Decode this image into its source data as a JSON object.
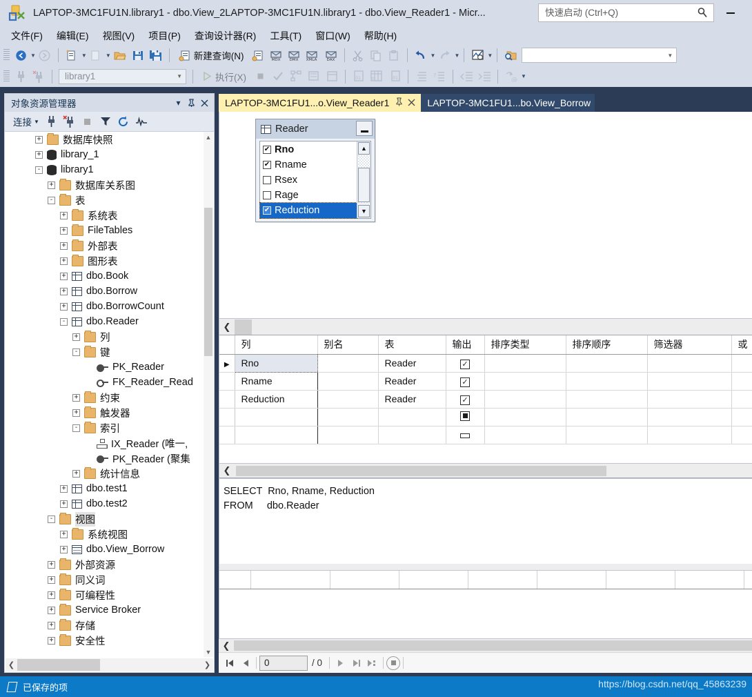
{
  "window": {
    "title": "LAPTOP-3MC1FU1N.library1 - dbo.View_2LAPTOP-3MC1FU1N.library1 - dbo.View_Reader1 - Micr...",
    "minimize_label": "",
    "app_icon": "ssms-icon"
  },
  "quick_launch": {
    "placeholder": "快速启动 (Ctrl+Q)",
    "value": "",
    "icon": "search-icon"
  },
  "menu": {
    "items": [
      {
        "label": "文件(F)"
      },
      {
        "label": "编辑(E)"
      },
      {
        "label": "视图(V)"
      },
      {
        "label": "项目(P)"
      },
      {
        "label": "查询设计器(R)"
      },
      {
        "label": "工具(T)"
      },
      {
        "label": "窗口(W)"
      },
      {
        "label": "帮助(H)"
      }
    ]
  },
  "toolbar1": {
    "new_query_label": "新建查询(N)",
    "buttons": [
      {
        "name": "navigate-back",
        "icon": "arrow-back-icon"
      },
      {
        "name": "navigate-forward",
        "icon": "arrow-forward-icon"
      },
      {
        "name": "new-project",
        "icon": "new-project-icon"
      },
      {
        "name": "add-item",
        "icon": "add-item-icon"
      },
      {
        "name": "open-file",
        "icon": "folder-open-icon"
      },
      {
        "name": "save",
        "icon": "save-icon"
      },
      {
        "name": "save-all",
        "icon": "save-all-icon"
      },
      {
        "name": "new-query",
        "icon": "new-query-icon"
      },
      {
        "name": "new-analysis-query",
        "icon": "analysis-query-icon"
      },
      {
        "name": "new-mdx-query",
        "icon": "mdx-icon",
        "text": "MDX"
      },
      {
        "name": "new-dmx-query",
        "icon": "dmx-icon",
        "text": "DMX"
      },
      {
        "name": "new-xmla-query",
        "icon": "xmla-icon",
        "text": "XMLA"
      },
      {
        "name": "new-dax-query",
        "icon": "dax-icon",
        "text": "DAX"
      },
      {
        "name": "cut",
        "icon": "scissors-icon"
      },
      {
        "name": "copy",
        "icon": "copy-icon"
      },
      {
        "name": "paste",
        "icon": "paste-icon"
      },
      {
        "name": "undo",
        "icon": "undo-icon"
      },
      {
        "name": "redo",
        "icon": "redo-icon"
      },
      {
        "name": "activity-monitor",
        "icon": "activity-monitor-icon"
      },
      {
        "name": "find-in-files",
        "icon": "find-folder-icon"
      }
    ],
    "combo_value": "",
    "combo_placeholder": ""
  },
  "toolbar2": {
    "database_combo_value": "library1",
    "execute_label": "执行(X)",
    "buttons": [
      {
        "name": "connect",
        "icon": "connect-icon"
      },
      {
        "name": "disconnect",
        "icon": "disconnect-icon"
      },
      {
        "name": "execute",
        "icon": "play-icon"
      },
      {
        "name": "stop",
        "icon": "stop-icon"
      },
      {
        "name": "parse",
        "icon": "checkmark-icon"
      },
      {
        "name": "display-estimated-plan",
        "icon": "estimated-plan-icon"
      },
      {
        "name": "include-actual-plan",
        "icon": "actual-plan-icon"
      },
      {
        "name": "include-client-statistics",
        "icon": "client-stats-icon"
      },
      {
        "name": "results-to-text",
        "icon": "results-text-icon"
      },
      {
        "name": "results-to-grid",
        "icon": "results-grid-icon"
      },
      {
        "name": "results-to-file",
        "icon": "results-file-icon"
      },
      {
        "name": "comment-lines",
        "icon": "comment-icon"
      },
      {
        "name": "uncomment-lines",
        "icon": "uncomment-icon"
      },
      {
        "name": "decrease-indent",
        "icon": "outdent-icon"
      },
      {
        "name": "increase-indent",
        "icon": "indent-icon"
      },
      {
        "name": "specify-values-template",
        "icon": "template-params-icon"
      }
    ]
  },
  "object_explorer": {
    "title": "对象资源管理器",
    "connect_label": "连接",
    "toolbar_icons": [
      {
        "name": "connect-icon"
      },
      {
        "name": "disconnect-icon"
      },
      {
        "name": "stop-icon"
      },
      {
        "name": "filter-icon"
      },
      {
        "name": "refresh-icon"
      },
      {
        "name": "activity-monitor-icon"
      }
    ],
    "tree": [
      {
        "label": "数据库快照",
        "indent": 2,
        "expander": "+",
        "icon": "folder",
        "selected": false
      },
      {
        "label": "library_1",
        "indent": 2,
        "expander": "+",
        "icon": "database",
        "selected": false
      },
      {
        "label": "library1",
        "indent": 2,
        "expander": "-",
        "icon": "database",
        "selected": false
      },
      {
        "label": "数据库关系图",
        "indent": 3,
        "expander": "+",
        "icon": "folder",
        "selected": false
      },
      {
        "label": "表",
        "indent": 3,
        "expander": "-",
        "icon": "folder",
        "selected": false
      },
      {
        "label": "系统表",
        "indent": 4,
        "expander": "+",
        "icon": "folder",
        "selected": false
      },
      {
        "label": "FileTables",
        "indent": 4,
        "expander": "+",
        "icon": "folder",
        "selected": false
      },
      {
        "label": "外部表",
        "indent": 4,
        "expander": "+",
        "icon": "folder",
        "selected": false
      },
      {
        "label": "图形表",
        "indent": 4,
        "expander": "+",
        "icon": "folder",
        "selected": false
      },
      {
        "label": "dbo.Book",
        "indent": 4,
        "expander": "+",
        "icon": "table",
        "selected": false
      },
      {
        "label": "dbo.Borrow",
        "indent": 4,
        "expander": "+",
        "icon": "table",
        "selected": false
      },
      {
        "label": "dbo.BorrowCount",
        "indent": 4,
        "expander": "+",
        "icon": "table",
        "selected": false
      },
      {
        "label": "dbo.Reader",
        "indent": 4,
        "expander": "-",
        "icon": "table",
        "selected": false
      },
      {
        "label": "列",
        "indent": 5,
        "expander": "+",
        "icon": "folder",
        "selected": false
      },
      {
        "label": "键",
        "indent": 5,
        "expander": "-",
        "icon": "folder",
        "selected": false
      },
      {
        "label": "PK_Reader",
        "indent": 6,
        "expander": "",
        "icon": "key-filled",
        "selected": false
      },
      {
        "label": "FK_Reader_Read",
        "indent": 6,
        "expander": "",
        "icon": "key",
        "selected": false
      },
      {
        "label": "约束",
        "indent": 5,
        "expander": "+",
        "icon": "folder",
        "selected": false
      },
      {
        "label": "触发器",
        "indent": 5,
        "expander": "+",
        "icon": "folder",
        "selected": false
      },
      {
        "label": "索引",
        "indent": 5,
        "expander": "-",
        "icon": "folder",
        "selected": false
      },
      {
        "label": "IX_Reader (唯一,",
        "indent": 6,
        "expander": "",
        "icon": "index",
        "selected": false
      },
      {
        "label": "PK_Reader (聚集",
        "indent": 6,
        "expander": "",
        "icon": "key-filled",
        "selected": false
      },
      {
        "label": "统计信息",
        "indent": 5,
        "expander": "+",
        "icon": "folder",
        "selected": false
      },
      {
        "label": "dbo.test1",
        "indent": 4,
        "expander": "+",
        "icon": "table",
        "selected": false
      },
      {
        "label": "dbo.test2",
        "indent": 4,
        "expander": "+",
        "icon": "table",
        "selected": false
      },
      {
        "label": "视图",
        "indent": 3,
        "expander": "-",
        "icon": "folder",
        "selected": true
      },
      {
        "label": "系统视图",
        "indent": 4,
        "expander": "+",
        "icon": "folder",
        "selected": false
      },
      {
        "label": "dbo.View_Borrow",
        "indent": 4,
        "expander": "+",
        "icon": "view",
        "selected": false
      },
      {
        "label": "外部资源",
        "indent": 3,
        "expander": "+",
        "icon": "folder",
        "selected": false
      },
      {
        "label": "同义词",
        "indent": 3,
        "expander": "+",
        "icon": "folder",
        "selected": false
      },
      {
        "label": "可编程性",
        "indent": 3,
        "expander": "+",
        "icon": "folder",
        "selected": false
      },
      {
        "label": "Service Broker",
        "indent": 3,
        "expander": "+",
        "icon": "folder",
        "selected": false
      },
      {
        "label": "存储",
        "indent": 3,
        "expander": "+",
        "icon": "folder",
        "selected": false
      },
      {
        "label": "安全性",
        "indent": 3,
        "expander": "+",
        "icon": "folder",
        "selected": false
      }
    ]
  },
  "tabs": [
    {
      "label": "LAPTOP-3MC1FU1...o.View_Reader1",
      "active": true,
      "pin_icon": "pin-icon",
      "close_icon": "close-icon"
    },
    {
      "label": "LAPTOP-3MC1FU1...bo.View_Borrow",
      "active": false
    }
  ],
  "diagram": {
    "table": {
      "name": "Reader",
      "icon": "table-icon",
      "minimize_icon": "minimize-icon",
      "columns": [
        {
          "label": "Rno",
          "checked": true,
          "bold": true,
          "selected": false
        },
        {
          "label": "Rname",
          "checked": true,
          "bold": false,
          "selected": false
        },
        {
          "label": "Rsex",
          "checked": false,
          "bold": false,
          "selected": false
        },
        {
          "label": "Rage",
          "checked": false,
          "bold": false,
          "selected": false
        },
        {
          "label": "Reduction",
          "checked": true,
          "bold": false,
          "selected": true
        }
      ]
    }
  },
  "criteria_grid": {
    "headers": [
      "列",
      "别名",
      "表",
      "输出",
      "排序类型",
      "排序顺序",
      "筛选器",
      "或"
    ],
    "rows": [
      {
        "pointer": "▶",
        "column": "Rno",
        "alias": "",
        "table": "Reader",
        "output": "checked",
        "sort_type": "",
        "sort_order": "",
        "filter": "",
        "or": "",
        "active": true
      },
      {
        "pointer": "",
        "column": "Rname",
        "alias": "",
        "table": "Reader",
        "output": "checked",
        "sort_type": "",
        "sort_order": "",
        "filter": "",
        "or": "",
        "active": false
      },
      {
        "pointer": "",
        "column": "Reduction",
        "alias": "",
        "table": "Reader",
        "output": "checked",
        "sort_type": "",
        "sort_order": "",
        "filter": "",
        "or": "",
        "active": false
      },
      {
        "pointer": "",
        "column": "",
        "alias": "",
        "table": "",
        "output": "filled",
        "sort_type": "",
        "sort_order": "",
        "filter": "",
        "or": "",
        "active": false
      },
      {
        "pointer": "",
        "column": "",
        "alias": "",
        "table": "",
        "output": "partial",
        "sort_type": "",
        "sort_order": "",
        "filter": "",
        "or": "",
        "active": false
      }
    ]
  },
  "sql_pane": {
    "text": "SELECT  Rno, Rname, Reduction\nFROM     dbo.Reader"
  },
  "results": {
    "row_count": 1,
    "column_count": 8
  },
  "navigation": {
    "current_record": "0",
    "total_label": "/ 0",
    "buttons": [
      {
        "name": "first-record",
        "icon": "first-icon"
      },
      {
        "name": "previous-record",
        "icon": "prev-icon"
      },
      {
        "name": "next-record",
        "icon": "next-icon"
      },
      {
        "name": "last-record",
        "icon": "last-icon"
      },
      {
        "name": "new-record",
        "icon": "new-record-icon"
      },
      {
        "name": "stop-loading",
        "icon": "stop-circle-icon"
      }
    ]
  },
  "status_bar": {
    "text": "已保存的项",
    "icon": "saved-item-icon",
    "watermark": "https://blog.csdn.net/qq_45863239"
  }
}
